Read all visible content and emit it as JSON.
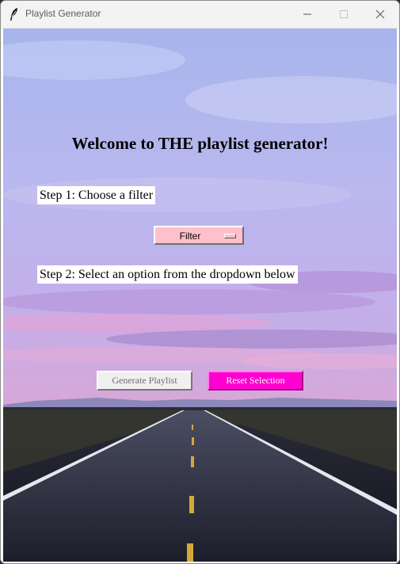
{
  "window": {
    "title": "Playlist Generator"
  },
  "icons": {
    "app": "feather-icon",
    "minimize": "minimize-icon",
    "maximize": "maximize-icon",
    "close": "close-icon"
  },
  "main": {
    "heading": "Welcome to THE playlist generator!",
    "step1": "Step 1: Choose a filter",
    "filter_button": "Filter",
    "step2": "Step 2: Select an option from the dropdown below",
    "generate_button": "Generate Playlist",
    "reset_button": "Reset Selection"
  },
  "colors": {
    "filter_button_bg": "#ffc0cb",
    "reset_button_bg": "#ff00d0",
    "generate_button_bg": "#f0f0f0"
  }
}
